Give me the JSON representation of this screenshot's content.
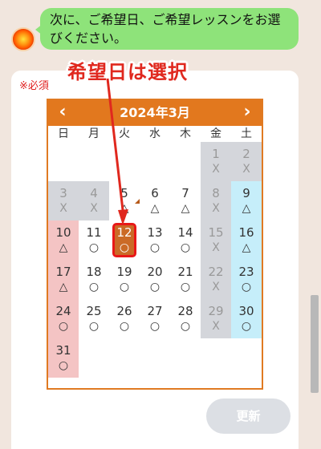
{
  "chat": {
    "message": "次に、ご希望日、ご希望レッスンをお選びください。"
  },
  "form": {
    "required_label": "※必須",
    "annotation": "希望日は選択",
    "update_label": "更新"
  },
  "calendar": {
    "title": "2024年3月",
    "prev_icon": "‹",
    "next_icon": "›",
    "weekdays": [
      "日",
      "月",
      "火",
      "水",
      "木",
      "金",
      "土"
    ],
    "selected_day": "12",
    "days": [
      {
        "d": "",
        "s": ""
      },
      {
        "d": "",
        "s": ""
      },
      {
        "d": "",
        "s": ""
      },
      {
        "d": "",
        "s": ""
      },
      {
        "d": "",
        "s": ""
      },
      {
        "d": "1",
        "s": "X"
      },
      {
        "d": "2",
        "s": "X"
      },
      {
        "d": "3",
        "s": "X"
      },
      {
        "d": "4",
        "s": "X"
      },
      {
        "d": "5",
        "s": "△"
      },
      {
        "d": "6",
        "s": "△"
      },
      {
        "d": "7",
        "s": "△"
      },
      {
        "d": "8",
        "s": "X"
      },
      {
        "d": "9",
        "s": "△"
      },
      {
        "d": "10",
        "s": "△"
      },
      {
        "d": "11",
        "s": "○"
      },
      {
        "d": "12",
        "s": "○"
      },
      {
        "d": "13",
        "s": "○"
      },
      {
        "d": "14",
        "s": "○"
      },
      {
        "d": "15",
        "s": "X"
      },
      {
        "d": "16",
        "s": "△"
      },
      {
        "d": "17",
        "s": "△"
      },
      {
        "d": "18",
        "s": "○"
      },
      {
        "d": "19",
        "s": "○"
      },
      {
        "d": "20",
        "s": "○"
      },
      {
        "d": "21",
        "s": "○"
      },
      {
        "d": "22",
        "s": "X"
      },
      {
        "d": "23",
        "s": "○"
      },
      {
        "d": "24",
        "s": "○"
      },
      {
        "d": "25",
        "s": "○"
      },
      {
        "d": "26",
        "s": "○"
      },
      {
        "d": "27",
        "s": "○"
      },
      {
        "d": "28",
        "s": "○"
      },
      {
        "d": "29",
        "s": "X"
      },
      {
        "d": "30",
        "s": "○"
      },
      {
        "d": "31",
        "s": "○"
      }
    ]
  },
  "colors": {
    "accent": "#e2781e",
    "chat_bubble": "#8ee37a",
    "sunday": "#f4c4c4",
    "saturday": "#c6eefa",
    "unavailable": "#d4d6db",
    "annotation_red": "#e0281e"
  }
}
